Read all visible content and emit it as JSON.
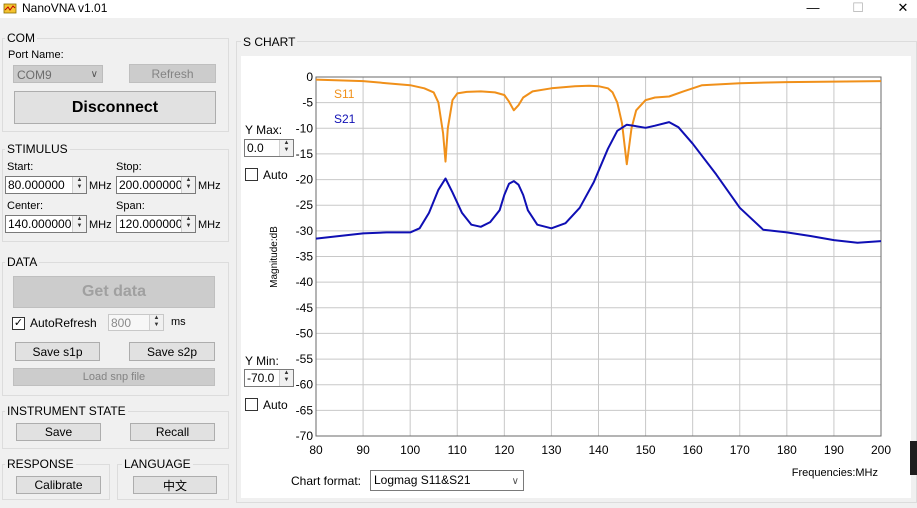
{
  "window": {
    "title": "NanoVNA v1.01",
    "minimize_glyph": "—",
    "maximize_glyph": "☐",
    "close_glyph": "✕"
  },
  "com": {
    "group_title": "COM",
    "port_label": "Port Name:",
    "port_value": "COM9",
    "refresh_label": "Refresh",
    "disconnect_label": "Disconnect"
  },
  "stimulus": {
    "group_title": "STIMULUS",
    "start_label": "Start:",
    "start_value": "80.000000",
    "stop_label": "Stop:",
    "stop_value": "200.000000",
    "center_label": "Center:",
    "center_value": "140.000000",
    "span_label": "Span:",
    "span_value": "120.000000",
    "unit": "MHz"
  },
  "data_group": {
    "group_title": "DATA",
    "get_data_label": "Get data",
    "autorefresh_label": "AutoRefresh",
    "autorefresh_checked": true,
    "interval_value": "800",
    "interval_unit": "ms",
    "save_s1p_label": "Save s1p",
    "save_s2p_label": "Save s2p",
    "load_snp_label": "Load snp file"
  },
  "instrument_state": {
    "group_title": "INSTRUMENT STATE",
    "save_label": "Save",
    "recall_label": "Recall"
  },
  "response": {
    "group_title": "RESPONSE",
    "calibrate_label": "Calibrate"
  },
  "language": {
    "group_title": "LANGUAGE",
    "button_label": "中文"
  },
  "s_chart": {
    "group_title": "S CHART",
    "ymax_label": "Y Max:",
    "ymax_value": "0.0",
    "ymax_auto_label": "Auto",
    "ymin_label": "Y Min:",
    "ymin_value": "-70.0",
    "ymin_auto_label": "Auto",
    "chart_format_label": "Chart format:",
    "chart_format_value": "Logmag S11&S21"
  },
  "colors": {
    "s11": "#f0901a",
    "s21": "#0f0fb4",
    "grid": "#c8c8c8"
  },
  "chart_data": {
    "type": "line",
    "xlabel": "Frequencies:MHz",
    "ylabel": "Magnitude:dB",
    "xlim": [
      80,
      200
    ],
    "ylim": [
      -70,
      0
    ],
    "xticks": [
      80,
      90,
      100,
      110,
      120,
      130,
      140,
      150,
      160,
      170,
      180,
      190,
      200
    ],
    "yticks": [
      0,
      -5,
      -10,
      -15,
      -20,
      -25,
      -30,
      -35,
      -40,
      -45,
      -50,
      -55,
      -60,
      -65,
      -70
    ],
    "grid": true,
    "legend_position": "top-left",
    "series": [
      {
        "name": "S11",
        "x": [
          80,
          90,
          95,
          100,
          103,
          105,
          106,
          107,
          107.5,
          108,
          109,
          110,
          112,
          115,
          118,
          120,
          121,
          122,
          123,
          124,
          126,
          130,
          135,
          138,
          140,
          142,
          143,
          144,
          145,
          146,
          147,
          148,
          150,
          152,
          155,
          158,
          162,
          170,
          180,
          190,
          200
        ],
        "y": [
          -0.5,
          -0.8,
          -1.2,
          -1.6,
          -2.2,
          -3,
          -5,
          -11,
          -16.5,
          -10,
          -4.5,
          -3.2,
          -2.9,
          -2.8,
          -3,
          -3.5,
          -4.8,
          -6.5,
          -5.5,
          -4,
          -2.8,
          -2.2,
          -1.8,
          -1.7,
          -1.8,
          -2.2,
          -3,
          -5,
          -9,
          -17,
          -10,
          -6.5,
          -4.5,
          -4,
          -3.8,
          -2.8,
          -1.6,
          -1.2,
          -1.0,
          -0.9,
          -0.8
        ]
      },
      {
        "name": "S21",
        "x": [
          80,
          85,
          90,
          95,
          100,
          102,
          104,
          106,
          107.5,
          109,
          111,
          113,
          115,
          117,
          119,
          120,
          121,
          122,
          123,
          124,
          125,
          127,
          130,
          133,
          136,
          139,
          142,
          144,
          146,
          148,
          150,
          152,
          155,
          157,
          160,
          165,
          170,
          175,
          180,
          185,
          190,
          195,
          200
        ],
        "y": [
          -31.5,
          -31,
          -30.5,
          -30.3,
          -30.3,
          -29.5,
          -26.5,
          -22,
          -19.8,
          -22.5,
          -26.5,
          -28.8,
          -29.2,
          -28.3,
          -26,
          -23,
          -20.8,
          -20.3,
          -21,
          -23,
          -26,
          -28.8,
          -29.5,
          -28.5,
          -25.5,
          -20.5,
          -14,
          -10.5,
          -9.3,
          -9.6,
          -9.9,
          -9.5,
          -8.8,
          -9.8,
          -13,
          -19,
          -25.5,
          -29.8,
          -30.3,
          -31,
          -31.8,
          -32.3,
          -32
        ]
      }
    ]
  }
}
